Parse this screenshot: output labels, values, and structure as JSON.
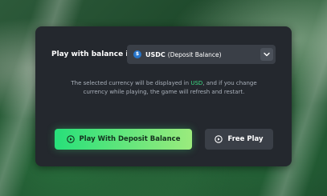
{
  "modal": {
    "balance_label": "Play with balance in",
    "currency": {
      "icon": "usdc-coin-icon",
      "icon_glyph": "$",
      "code": "USDC",
      "description": "(Deposit Balance)"
    },
    "note": {
      "prefix": "The selected currency will be displayed in ",
      "highlight": "USD",
      "suffix": ", and if you change currency while playing, the game will refresh and restart."
    },
    "primary_button": {
      "label": "Play With Deposit Balance",
      "icon": "play-circle-icon"
    },
    "secondary_button": {
      "label": "Free Play",
      "icon": "play-circle-icon"
    }
  },
  "colors": {
    "modal_bg": "#24282e",
    "accent_green": "#3ddc84",
    "usdc_blue": "#2775ca",
    "primary_gradient_start": "#27e07a",
    "primary_gradient_end": "#9beb7d"
  }
}
